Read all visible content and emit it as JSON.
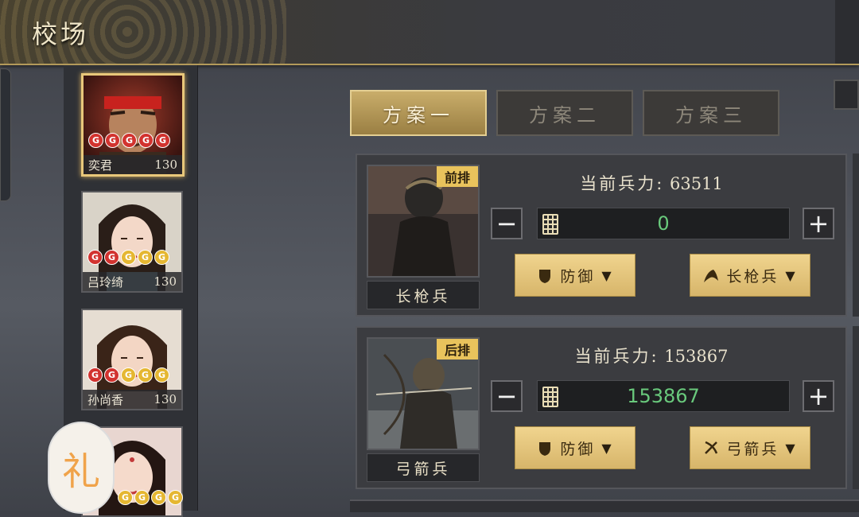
{
  "header": {
    "title": "校场"
  },
  "heroes": [
    {
      "name": "奕君",
      "level": "130",
      "stars": [
        "red",
        "red",
        "red",
        "red",
        "red"
      ],
      "selected": true
    },
    {
      "name": "吕玲绮",
      "level": "130",
      "stars": [
        "red",
        "red",
        "gold",
        "gold",
        "gold"
      ],
      "selected": false
    },
    {
      "name": "孙尚香",
      "level": "130",
      "stars": [
        "red",
        "red",
        "gold",
        "gold",
        "gold"
      ],
      "selected": false
    },
    {
      "name": "",
      "level": "",
      "stars": [
        "gold",
        "gold",
        "gold",
        "gold"
      ],
      "selected": false
    }
  ],
  "star_glyph": "G",
  "gift_glyph": "礼",
  "tabs": [
    {
      "label": "方案一",
      "active": true
    },
    {
      "label": "方案二",
      "active": false
    },
    {
      "label": "方案三",
      "active": false
    }
  ],
  "troops": [
    {
      "position": "前排",
      "name": "长枪兵",
      "strength_label": "当前兵力:",
      "strength_value": "63511",
      "assigned": "0",
      "stance": "防御",
      "type": "长枪兵"
    },
    {
      "position": "后排",
      "name": "弓箭兵",
      "strength_label": "当前兵力:",
      "strength_value": "153867",
      "assigned": "153867",
      "stance": "防御",
      "type": "弓箭兵"
    }
  ],
  "controls": {
    "minus": "−",
    "plus": "+",
    "caret": "▼"
  },
  "colors": {
    "accent_gold": "#e8c77a",
    "value_green": "#69c97c",
    "star_red": "#d2332f",
    "star_gold": "#e5b732"
  },
  "icons": [
    "calculator-icon",
    "shield-icon",
    "spear-cavalry-icon",
    "bow-icon",
    "caret-down-icon"
  ]
}
